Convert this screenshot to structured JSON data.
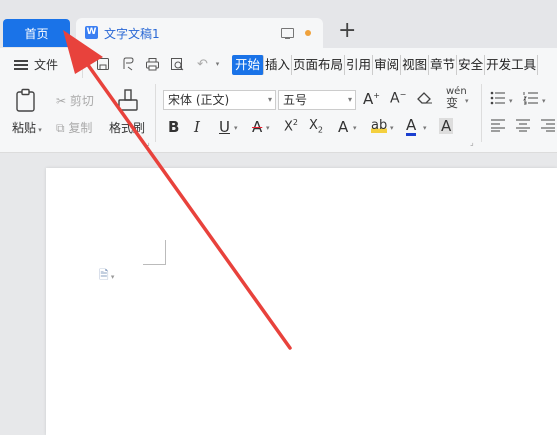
{
  "tabs": {
    "home": "首页",
    "doc_title": "文字文稿1",
    "doc_icon": "W",
    "new_tab": "+"
  },
  "menu": {
    "file": "文件",
    "ribbon_tabs": [
      "开始",
      "插入",
      "页面布局",
      "引用",
      "审阅",
      "视图",
      "章节",
      "安全",
      "开发工具"
    ]
  },
  "toolbar": {
    "paste": "粘贴",
    "cut": "剪切",
    "copy": "复制",
    "format_painter": "格式刷",
    "font_name": "宋体 (正文)",
    "font_size": "五号",
    "grow_font": "A⁺",
    "shrink_font": "A⁻",
    "phonetic": "wén"
  },
  "colors": {
    "accent": "#1a73e8",
    "arrow": "#e8423c",
    "tab_dot": "#f0a23c"
  }
}
